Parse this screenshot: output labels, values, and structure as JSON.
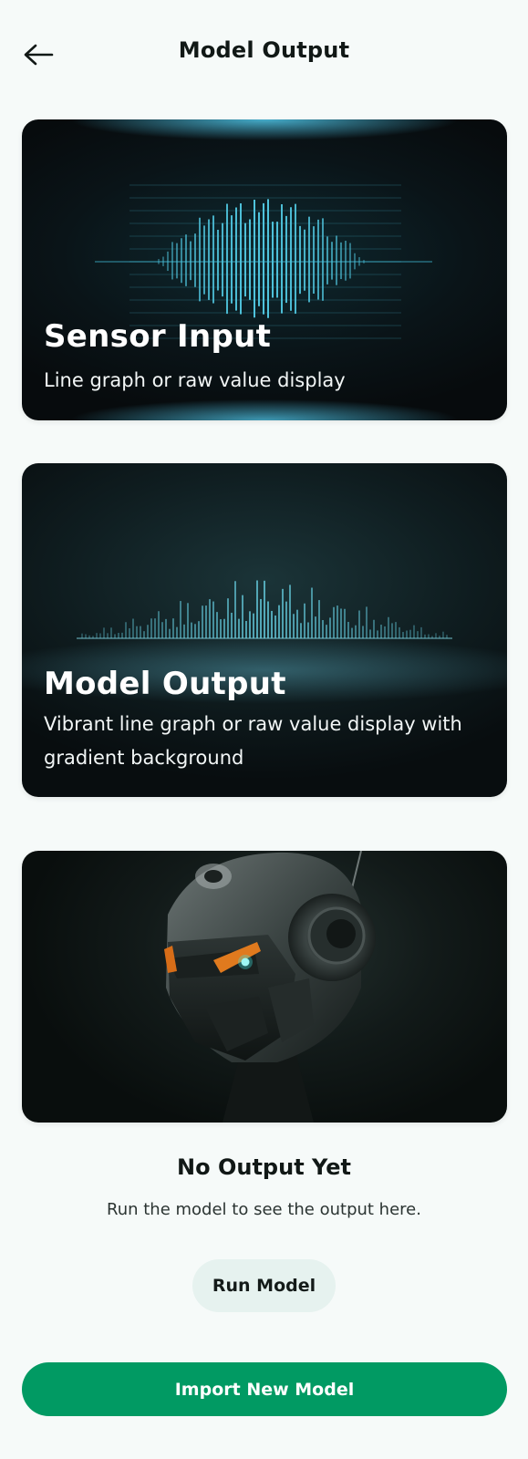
{
  "header": {
    "title": "Model Output",
    "back_icon": "arrow-left-icon"
  },
  "cards": [
    {
      "title": "Sensor Input",
      "description": "Line graph or raw value display",
      "accent": "#4fc3dc"
    },
    {
      "title": "Model Output",
      "description": "Vibrant line graph or raw value display with gradient background",
      "accent": "#5bb7c8"
    },
    {
      "image": "robot-head-illustration",
      "accent": "#3ee6e0"
    }
  ],
  "empty_state": {
    "title": "No Output Yet",
    "message": "Run the model to see the output here.",
    "run_button": "Run Model"
  },
  "footer": {
    "import_button": "Import New Model"
  },
  "colors": {
    "primary": "#019a63",
    "secondary_button": "#e6f2ef",
    "background": "#f6faf9"
  }
}
